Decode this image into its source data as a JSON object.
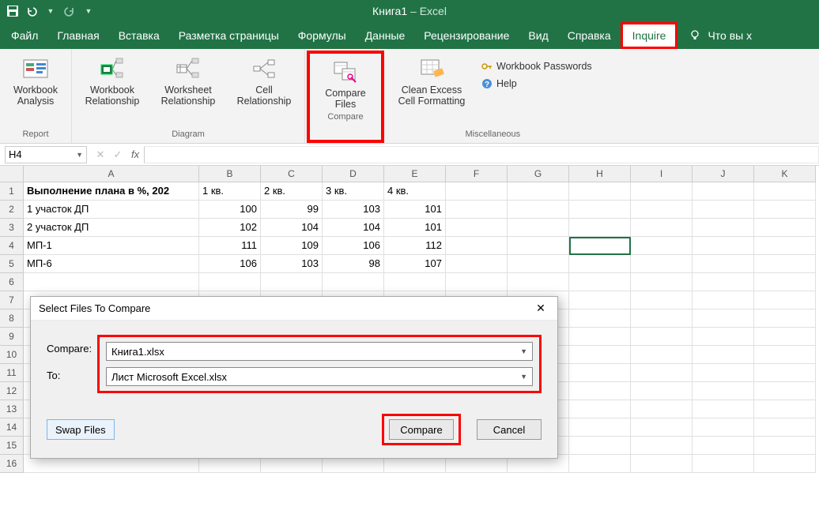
{
  "titlebar": {
    "doc": "Книга1",
    "app": "Excel"
  },
  "tabs": {
    "file": "Файл",
    "home": "Главная",
    "insert": "Вставка",
    "layout": "Разметка страницы",
    "formulas": "Формулы",
    "data": "Данные",
    "review": "Рецензирование",
    "view": "Вид",
    "help": "Справка",
    "inquire": "Inquire",
    "tellme": "Что вы х"
  },
  "ribbon": {
    "report": {
      "analysis": "Workbook Analysis",
      "label": "Report"
    },
    "diagram": {
      "wb": "Workbook Relationship",
      "ws": "Worksheet Relationship",
      "cell": "Cell Relationship",
      "label": "Diagram"
    },
    "compare": {
      "btn": "Compare Files",
      "label": "Compare"
    },
    "misc": {
      "clean": "Clean Excess Cell Formatting",
      "pw": "Workbook Passwords",
      "help": "Help",
      "label": "Miscellaneous"
    }
  },
  "fbar": {
    "name": "H4",
    "fx": "fx"
  },
  "cols": [
    "A",
    "B",
    "C",
    "D",
    "E",
    "F",
    "G",
    "H",
    "I",
    "J",
    "K"
  ],
  "sheet": {
    "r1": {
      "a": "Выполнение плана в %, 202",
      "b": "1 кв.",
      "c": "2 кв.",
      "d": "3 кв.",
      "e": "4 кв."
    },
    "r2": {
      "a": "1 участок ДП",
      "b": "100",
      "c": "99",
      "d": "103",
      "e": "101"
    },
    "r3": {
      "a": "2 участок ДП",
      "b": "102",
      "c": "104",
      "d": "104",
      "e": "101"
    },
    "r4": {
      "a": "МП-1",
      "b": "111",
      "c": "109",
      "d": "106",
      "e": "112"
    },
    "r5": {
      "a": "МП-6",
      "b": "106",
      "c": "103",
      "d": "98",
      "e": "107"
    }
  },
  "rows": [
    "1",
    "2",
    "3",
    "4",
    "5",
    "6",
    "7",
    "8",
    "9",
    "10",
    "11",
    "12",
    "13",
    "14",
    "15",
    "16"
  ],
  "dialog": {
    "title": "Select Files To Compare",
    "compare_lbl": "Compare:",
    "to_lbl": "To:",
    "compare_val": "Книга1.xlsx",
    "to_val": "Лист Microsoft Excel.xlsx",
    "swap": "Swap Files",
    "compare_btn": "Compare",
    "cancel": "Cancel"
  },
  "chart_data": {
    "type": "table",
    "title": "Выполнение плана в %, 202",
    "categories": [
      "1 кв.",
      "2 кв.",
      "3 кв.",
      "4 кв."
    ],
    "series": [
      {
        "name": "1 участок ДП",
        "values": [
          100,
          99,
          103,
          101
        ]
      },
      {
        "name": "2 участок ДП",
        "values": [
          102,
          104,
          104,
          101
        ]
      },
      {
        "name": "МП-1",
        "values": [
          111,
          109,
          106,
          112
        ]
      },
      {
        "name": "МП-6",
        "values": [
          106,
          103,
          98,
          107
        ]
      }
    ]
  }
}
